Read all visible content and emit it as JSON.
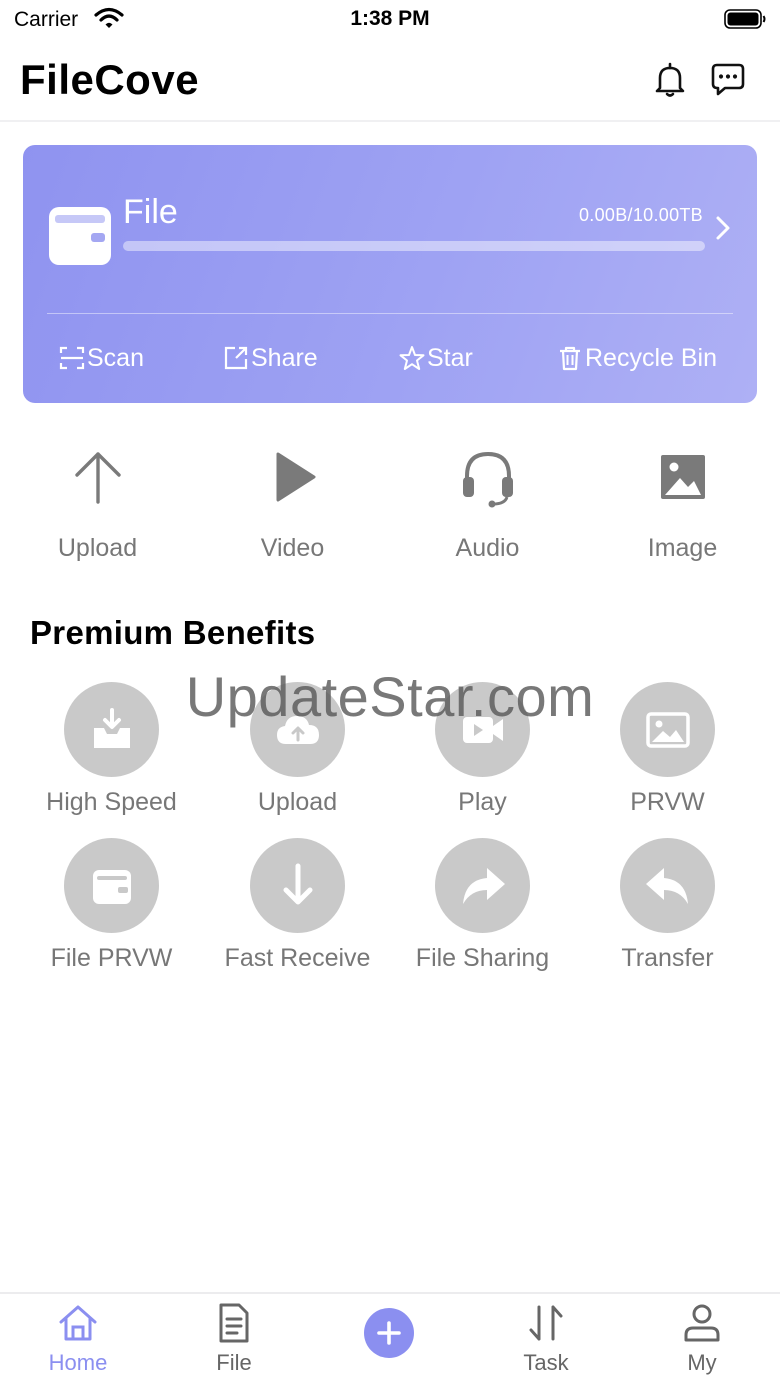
{
  "status_bar": {
    "carrier": "Carrier",
    "time": "1:38 PM"
  },
  "header": {
    "title": "FileCove",
    "bell_icon": "bell-icon",
    "message_icon": "chat-bubble-icon"
  },
  "storage": {
    "title": "File",
    "usage": "0.00B/10.00TB",
    "used_fraction": 0.0,
    "actions": [
      {
        "label": "Scan",
        "icon": "scan-icon"
      },
      {
        "label": "Share",
        "icon": "share-icon"
      },
      {
        "label": "Star",
        "icon": "star-icon"
      },
      {
        "label": "Recycle Bin",
        "icon": "trash-icon"
      }
    ]
  },
  "quick_actions": [
    {
      "label": "Upload",
      "icon": "upload-arrow-icon"
    },
    {
      "label": "Video",
      "icon": "play-icon"
    },
    {
      "label": "Audio",
      "icon": "headset-icon"
    },
    {
      "label": "Image",
      "icon": "image-icon"
    }
  ],
  "premium": {
    "title": "Premium Benefits",
    "items": [
      {
        "label": "High Speed",
        "icon": "download-tray-icon"
      },
      {
        "label": "Upload",
        "icon": "cloud-upload-icon"
      },
      {
        "label": "Play",
        "icon": "video-play-icon"
      },
      {
        "label": "PRVW",
        "icon": "image-preview-icon"
      },
      {
        "label": "File PRVW",
        "icon": "wallet-icon"
      },
      {
        "label": "Fast Receive",
        "icon": "arrow-down-icon"
      },
      {
        "label": "File Sharing",
        "icon": "forward-icon"
      },
      {
        "label": "Transfer",
        "icon": "reply-icon"
      }
    ]
  },
  "watermark": "UpdateStar.com",
  "tabs": [
    {
      "label": "Home",
      "icon": "home-icon",
      "active": true
    },
    {
      "label": "File",
      "icon": "document-icon",
      "active": false
    },
    {
      "label": "",
      "icon": "plus-icon",
      "active": false
    },
    {
      "label": "Task",
      "icon": "transfer-arrows-icon",
      "active": false
    },
    {
      "label": "My",
      "icon": "person-icon",
      "active": false
    }
  ],
  "colors": {
    "accent": "#8b8ff0",
    "card_start": "#8f93f0",
    "card_end": "#aeb0f5",
    "muted_icon": "#7a7a7a",
    "benefit_circle": "#c9c9c9"
  }
}
